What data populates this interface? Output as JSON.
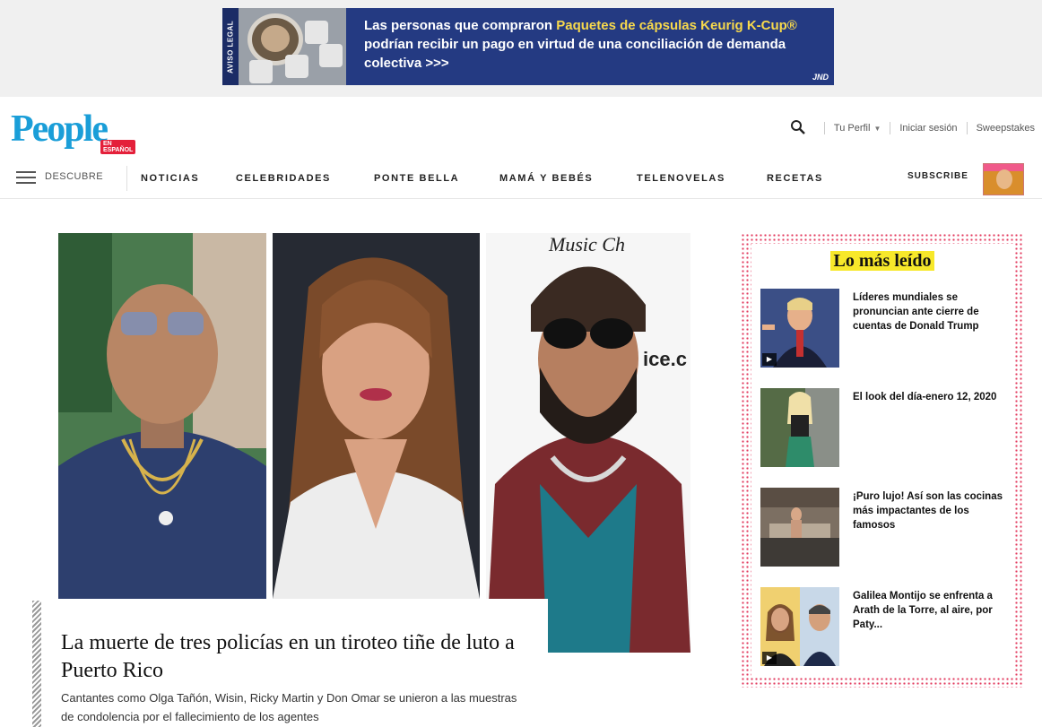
{
  "ad": {
    "legal_tag": "AVISO LEGAL",
    "text_before": "Las personas que compraron ",
    "text_highlight": "Paquetes de cápsulas Keurig K-Cup®",
    "text_after": " podrían recibir un pago en virtud de una conciliación de demanda colectiva >>>",
    "brand": "JND",
    "bg_color": "#243a82",
    "highlight_color": "#f7d94c"
  },
  "header": {
    "logo_text": "People",
    "logo_badge": "EN ESPAÑOL",
    "logo_color": "#1a9ed8",
    "profile_label": "Tu Perfil",
    "login_label": "Iniciar sesión",
    "sweepstakes_label": "Sweepstakes",
    "search_icon": "search-icon"
  },
  "nav": {
    "discover_label": "DESCUBRE",
    "items": [
      "NOTICIAS",
      "CELEBRIDADES",
      "PONTE BELLA",
      "MAMÁ Y BEBÉS",
      "TELENOVELAS",
      "RECETAS"
    ],
    "subscribe_label": "SUBSCRIBE"
  },
  "hero": {
    "headline": "La muerte de tres policías en un tiroteo tiñe de luto a Puerto Rico",
    "dek": "Cantantes como Olga Tañón, Wisin, Ricky Martin y Don Omar se unieron a las muestras de condolencia por el fallecimiento de los agentes",
    "backdrop_text": "Music Ch",
    "backdrop_text2": "ice.c"
  },
  "most_read": {
    "title": "Lo más leído",
    "accent_color": "#e23c60",
    "items": [
      {
        "title": "Líderes mundiales se pronuncian ante cierre de cuentas de Donald Trump",
        "video": true
      },
      {
        "title": "El look del día-enero 12, 2020",
        "video": false
      },
      {
        "title": "¡Puro lujo! Así son las cocinas más impactantes de los famosos",
        "video": false
      },
      {
        "title": "Galilea Montijo se enfrenta a Arath de la Torre, al aire, por Paty...",
        "video": true
      }
    ]
  }
}
